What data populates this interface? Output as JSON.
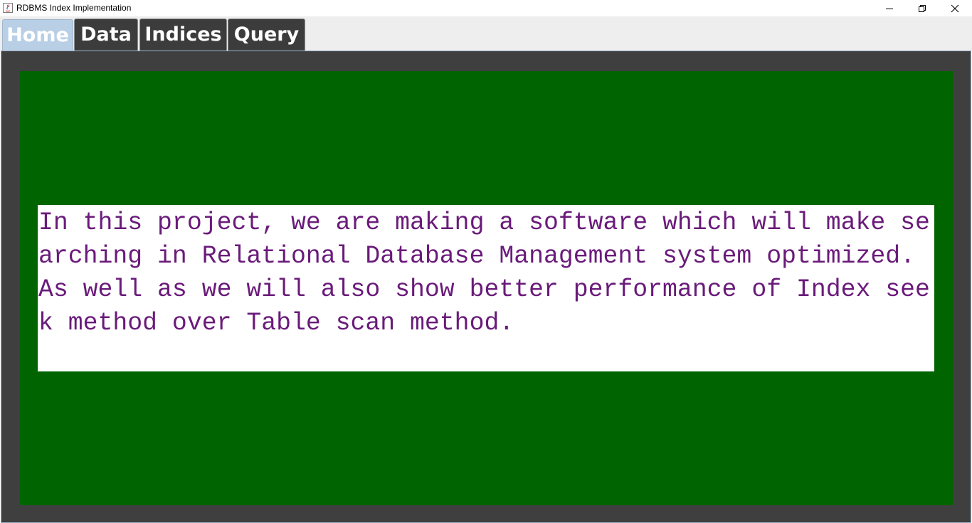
{
  "window": {
    "title": "RDBMS Index Implementation",
    "icons": {
      "app": "java-app-icon",
      "minimize": "minimize-icon",
      "restore": "restore-icon",
      "close": "close-icon"
    }
  },
  "tabs": [
    {
      "label": "Home",
      "selected": true
    },
    {
      "label": "Data",
      "selected": false
    },
    {
      "label": "Indices",
      "selected": false
    },
    {
      "label": "Query",
      "selected": false
    }
  ],
  "home": {
    "description": "In this project, we are making a software which will make searching in Relational Database Management system optimized. As well as we will also show better performance of Index seek method over Table scan method."
  },
  "colors": {
    "tab_selected_bg": "#b8cfe5",
    "tab_bg": "#3c3c3c",
    "outer_bg": "#3f3f3f",
    "panel_green": "#006400",
    "text_purple": "#6a1b7a"
  }
}
